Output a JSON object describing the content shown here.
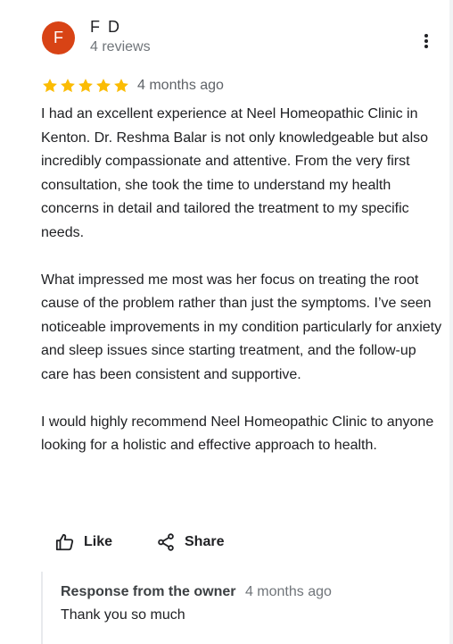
{
  "review": {
    "author_initial": "F",
    "author_name": "F D",
    "author_meta": "4 reviews",
    "rating": 5,
    "date": "4 months ago",
    "paragraphs": [
      "I had an excellent experience at Neel Homeopathic Clinic in Kenton. Dr. Reshma Balar is not only knowledgeable but also incredibly compassionate and attentive. From the very first consultation, she took the time to understand my health concerns in detail and tailored the treatment to my specific needs.",
      "What impressed me most was her focus on treating the root cause of the problem rather than just the symptoms. I’ve seen noticeable improvements in my condition particularly for anxiety and sleep issues since starting treatment, and the follow-up care has been consistent and supportive.",
      "I would highly recommend Neel Homeopathic Clinic to anyone looking for a holistic and effective approach to health."
    ]
  },
  "actions": {
    "like_label": "Like",
    "share_label": "Share"
  },
  "owner_response": {
    "label": "Response from the owner",
    "date": "4 months ago",
    "text": "Thank you so much"
  },
  "colors": {
    "avatar": "#d84315",
    "star": "#fbbc04",
    "muted_text": "#70757a"
  },
  "icons": {
    "menu": "more-vert-icon",
    "star": "star-icon",
    "like": "thumb-up-icon",
    "share": "share-icon"
  }
}
